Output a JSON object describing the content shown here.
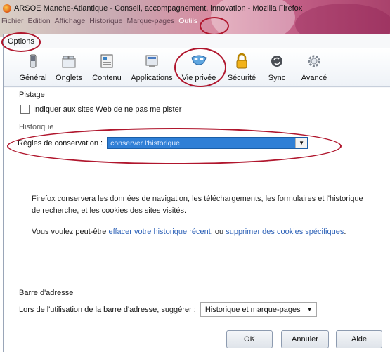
{
  "window": {
    "title": "ARSOE Manche-Atlantique - Conseil, accompagnement, innovation - Mozilla Firefox"
  },
  "menubar": {
    "items": [
      "Fichier",
      "Edition",
      "Affichage",
      "Historique",
      "Marque-pages",
      "Outils"
    ]
  },
  "dialog": {
    "title": "Options",
    "panes": [
      {
        "label": "Général",
        "icon": "general-switch-icon"
      },
      {
        "label": "Onglets",
        "icon": "tabs-icon"
      },
      {
        "label": "Contenu",
        "icon": "content-icon"
      },
      {
        "label": "Applications",
        "icon": "applications-icon"
      },
      {
        "label": "Vie privée",
        "icon": "privacy-mask-icon"
      },
      {
        "label": "Sécurité",
        "icon": "lock-icon"
      },
      {
        "label": "Sync",
        "icon": "sync-icon"
      },
      {
        "label": "Avancé",
        "icon": "gear-icon"
      }
    ],
    "selected_pane": "Vie privée"
  },
  "tracking": {
    "heading": "Pistage",
    "do_not_track_label": "Indiquer aux sites Web de ne pas me pister",
    "do_not_track_checked": false
  },
  "history": {
    "heading": "Historique",
    "rules_label": "Règles de conservation :",
    "rules_value": "conserver l'historique",
    "description_line1": "Firefox conservera les données de navigation, les téléchargements, les formulaires et l'historique",
    "description_line2": "de recherche, et les cookies des sites visités.",
    "suggest_prefix": "Vous voulez peut-être ",
    "clear_history_link": "effacer votre historique récent",
    "suggest_middle": ", ou ",
    "delete_cookies_link": "supprimer des cookies spécifiques",
    "suggest_suffix": "."
  },
  "address_bar": {
    "heading": "Barre d'adresse",
    "suggest_label": "Lors de l'utilisation de la barre d'adresse, suggérer :",
    "suggest_value": "Historique et marque-pages"
  },
  "buttons": {
    "ok": "OK",
    "cancel": "Annuler",
    "help": "Aide"
  },
  "colors": {
    "annotation_circle": "#b0162d",
    "selected_select": "#2f7fd6",
    "link": "#2f63b8"
  }
}
